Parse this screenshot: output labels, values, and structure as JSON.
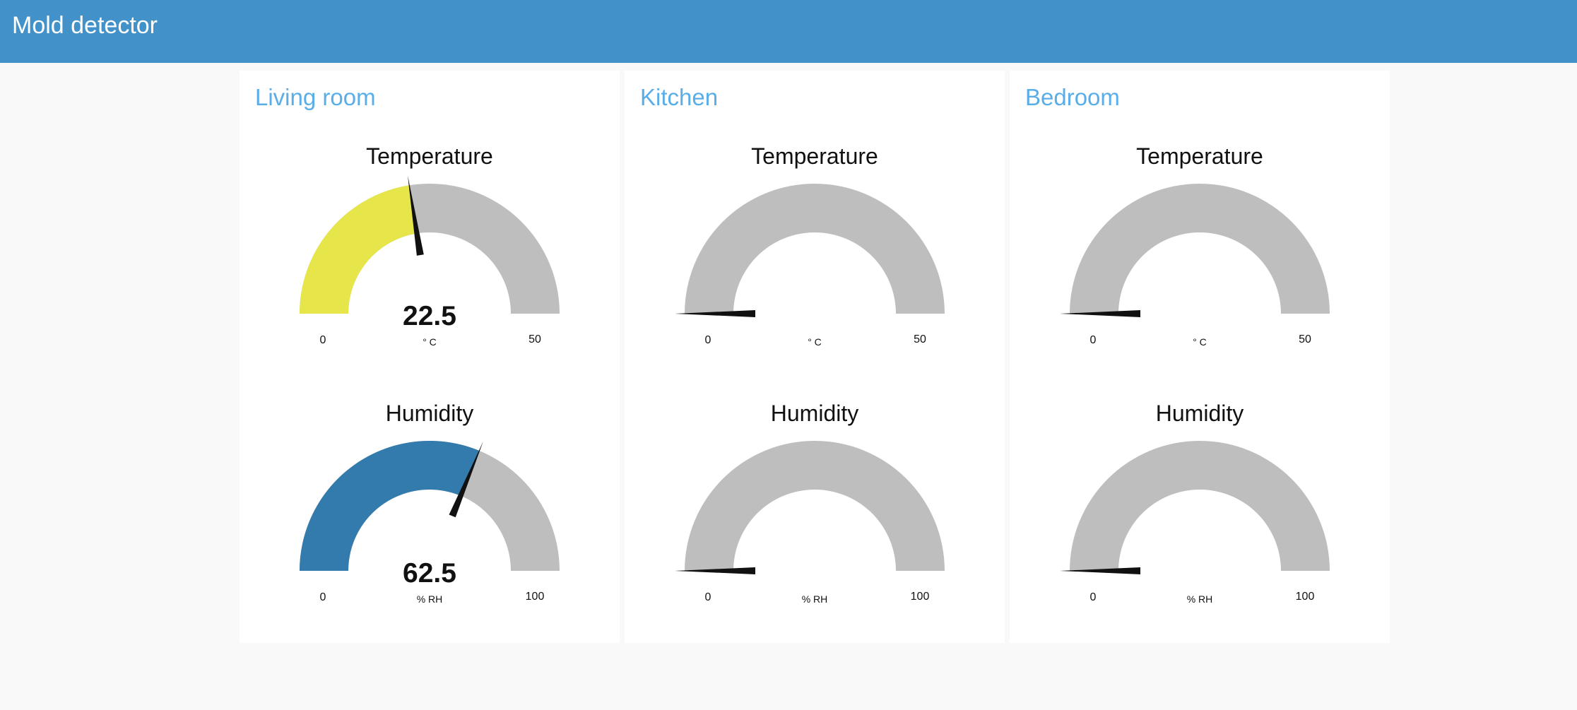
{
  "app": {
    "title": "Mold detector"
  },
  "colors": {
    "header": "#4292c9",
    "room_title": "#5aaee8",
    "gauge_track": "#bebebe",
    "temperature_fill": "#e6e549",
    "humidity_fill": "#337aad",
    "needle": "#111111"
  },
  "rooms": [
    {
      "name": "Living room",
      "temperature": {
        "title": "Temperature",
        "value": "22.5",
        "min": "0",
        "max": "50",
        "units": "° C"
      },
      "humidity": {
        "title": "Humidity",
        "value": "62.5",
        "min": "0",
        "max": "100",
        "units": "% RH"
      }
    },
    {
      "name": "Kitchen",
      "temperature": {
        "title": "Temperature",
        "value": "",
        "min": "0",
        "max": "50",
        "units": "° C"
      },
      "humidity": {
        "title": "Humidity",
        "value": "",
        "min": "0",
        "max": "100",
        "units": "% RH"
      }
    },
    {
      "name": "Bedroom",
      "temperature": {
        "title": "Temperature",
        "value": "",
        "min": "0",
        "max": "50",
        "units": "° C"
      },
      "humidity": {
        "title": "Humidity",
        "value": "",
        "min": "0",
        "max": "100",
        "units": "% RH"
      }
    }
  ]
}
